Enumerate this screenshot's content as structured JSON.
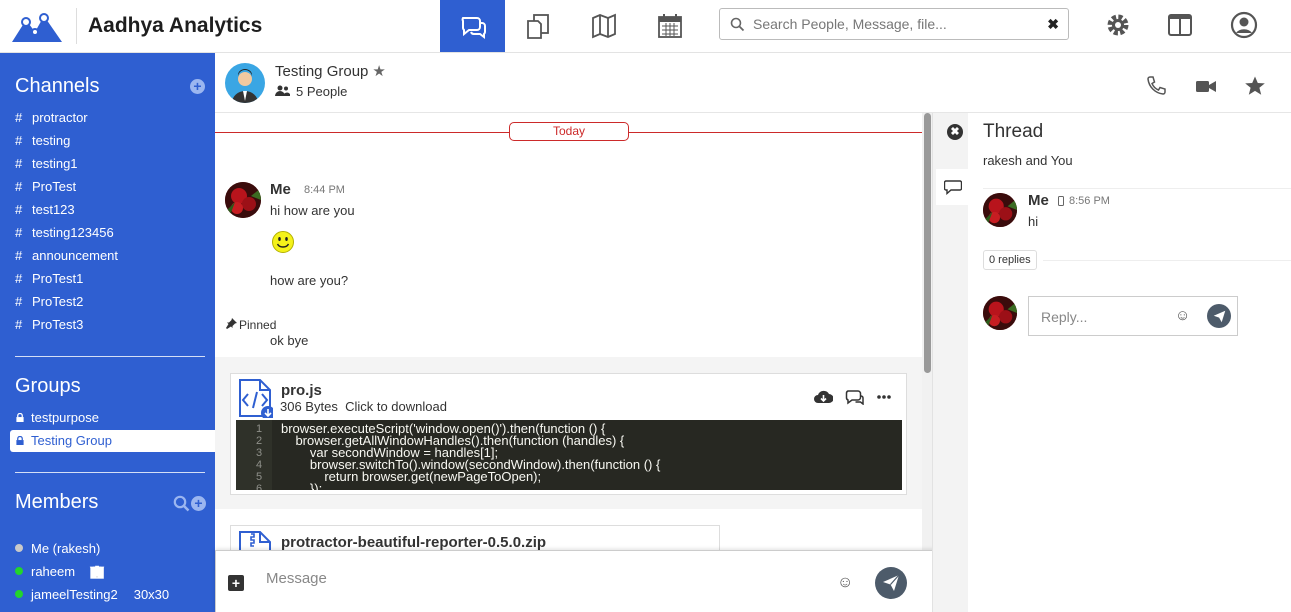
{
  "app": {
    "title": "Aadhya Analytics"
  },
  "nav": {
    "items": [
      {
        "name": "chat",
        "icon": "chat-bubbles-icon",
        "active": true
      },
      {
        "name": "files",
        "icon": "documents-icon",
        "active": false
      },
      {
        "name": "maps",
        "icon": "map-icon",
        "active": false
      },
      {
        "name": "calendar",
        "icon": "calendar-icon",
        "active": false
      }
    ],
    "accent": "#2f5fd1"
  },
  "search": {
    "placeholder": "Search People, Message, file...",
    "value": "",
    "clear_label": "✖"
  },
  "topicons": {
    "settings": "gear-icon",
    "layout": "split-panel-icon",
    "user": "user-icon"
  },
  "sidebar": {
    "channels_title": "Channels",
    "add_label": "+",
    "channels": [
      {
        "label": "protractor"
      },
      {
        "label": "testing"
      },
      {
        "label": "testing1"
      },
      {
        "label": "ProTest"
      },
      {
        "label": "test123"
      },
      {
        "label": "testing123456"
      },
      {
        "label": "announcement"
      },
      {
        "label": "ProTest1"
      },
      {
        "label": "ProTest2"
      },
      {
        "label": "ProTest3"
      }
    ],
    "hash": "#",
    "groups_title": "Groups",
    "groups": [
      {
        "label": "testpurpose",
        "active": false
      },
      {
        "label": "Testing Group",
        "active": true
      }
    ],
    "members_title": "Members",
    "members": [
      {
        "label": "Me (rakesh)",
        "status": "#c9c9c9"
      },
      {
        "label": "raheem",
        "status": "#22d52b"
      },
      {
        "label": "jameelTesting2",
        "status": "#22d52b",
        "extra": "30x30"
      }
    ]
  },
  "header": {
    "group_name": "Testing Group",
    "star": "★",
    "people": "5 People"
  },
  "messages": {
    "date_divider": "Today",
    "sender": "Me",
    "time": "8:44 PM",
    "lines": [
      "hi how are you",
      "how are you?"
    ],
    "pinned_label": "Pinned",
    "pinned_text": "ok bye",
    "file": {
      "name": "pro.js",
      "size": "306 Bytes",
      "action": "Click to download",
      "code_lines": [
        {
          "n": "1",
          "text": "browser.executeScript('window.open()').then(function () {"
        },
        {
          "n": "2",
          "text": "    browser.getAllWindowHandles().then(function (handles) {"
        },
        {
          "n": "3",
          "text": "        var secondWindow = handles[1];"
        },
        {
          "n": "4",
          "text": "        browser.switchTo().window(secondWindow).then(function () {"
        },
        {
          "n": "5",
          "text": "            return browser.get(newPageToOpen);"
        },
        {
          "n": "6",
          "text": "        });"
        }
      ]
    },
    "file2": {
      "name": "protractor-beautiful-reporter-0.5.0.zip"
    }
  },
  "composer": {
    "placeholder": "Message",
    "value": "",
    "add_label": "+",
    "emoji": "☺"
  },
  "side_tabs": {
    "close_label": "✖"
  },
  "thread": {
    "title": "Thread",
    "participants": "rakesh and You",
    "sender": "Me",
    "time": "8:56 PM",
    "text": "hi",
    "replies": "0 replies",
    "reply_placeholder": "Reply...",
    "emoji": "☺"
  }
}
